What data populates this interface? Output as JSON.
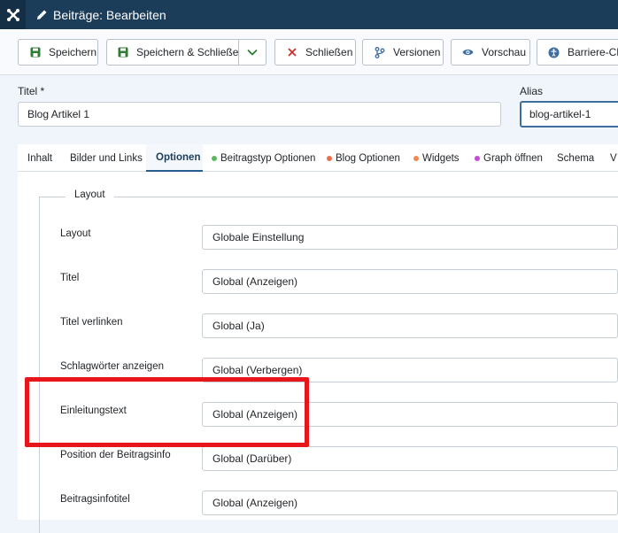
{
  "header": {
    "title": "Beiträge: Bearbeiten"
  },
  "toolbar": {
    "save": "Speichern",
    "save_close": "Speichern & Schließen",
    "close": "Schließen",
    "versions": "Versionen",
    "preview": "Vorschau",
    "accessibility": "Barriere-Che"
  },
  "form": {
    "title_label": "Titel *",
    "title_value": "Blog Artikel 1",
    "alias_label": "Alias",
    "alias_value": "blog-artikel-1"
  },
  "tabs": [
    {
      "label": "Inhalt"
    },
    {
      "label": "Bilder und Links"
    },
    {
      "label": "Optionen",
      "active": true
    },
    {
      "label": "Beitragstyp Optionen",
      "dot": "#5cb85c"
    },
    {
      "label": "Blog Optionen",
      "dot": "#ef6d4a"
    },
    {
      "label": "Widgets",
      "dot": "#f08a4b"
    },
    {
      "label": "Graph öffnen",
      "dot": "#c64bd6"
    },
    {
      "label": "Schema"
    },
    {
      "label": "V"
    }
  ],
  "layout": {
    "legend": "Layout",
    "fields": [
      {
        "label": "Layout",
        "value": "Globale Einstellung"
      },
      {
        "label": "Titel",
        "value": "Global (Anzeigen)"
      },
      {
        "label": "Titel verlinken",
        "value": "Global (Ja)"
      },
      {
        "label": "Schlagwörter anzeigen",
        "value": "Global (Verbergen)"
      },
      {
        "label": "Einleitungstext",
        "value": "Global (Anzeigen)"
      },
      {
        "label": "Position der Beitragsinfo",
        "value": "Global (Darüber)"
      },
      {
        "label": "Beitragsinfotitel",
        "value": "Global (Anzeigen)"
      }
    ]
  },
  "colors": {
    "header_bg": "#1c3d5a",
    "highlight": "#e8161b",
    "save_icon": "#2f7d32",
    "close_icon": "#c9302c",
    "accent": "#2a5d8f"
  }
}
